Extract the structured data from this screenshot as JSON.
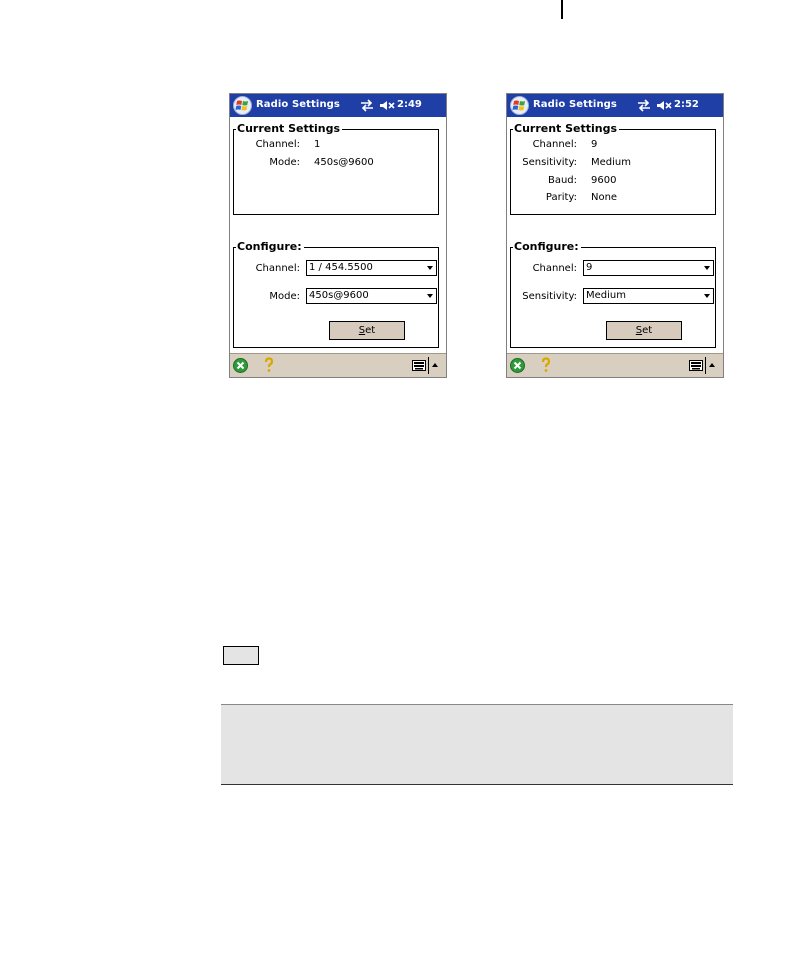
{
  "screens": [
    {
      "title": "Radio Settings",
      "time": "2:49",
      "current_title": "Current Settings",
      "current_rows": [
        {
          "label": "Channel:",
          "value": "1"
        },
        {
          "label": "Mode:",
          "value": "450s@9600"
        }
      ],
      "configure_title": "Configure:",
      "config_rows": [
        {
          "label": "Channel:",
          "value": "1 / 454.5500"
        },
        {
          "label": "Mode:",
          "value": "450s@9600"
        }
      ],
      "set_label_first": "S",
      "set_label_rest": "et"
    },
    {
      "title": "Radio Settings",
      "time": "2:52",
      "current_title": "Current Settings",
      "current_rows": [
        {
          "label": "Channel:",
          "value": "9"
        },
        {
          "label": "Sensitivity:",
          "value": "Medium"
        },
        {
          "label": "Baud:",
          "value": "9600"
        },
        {
          "label": "Parity:",
          "value": "None"
        }
      ],
      "configure_title": "Configure:",
      "config_rows": [
        {
          "label": "Channel:",
          "value": "9"
        },
        {
          "label": "Sensitivity:",
          "value": "Medium"
        }
      ],
      "set_label_first": "S",
      "set_label_rest": "et"
    }
  ],
  "colors": {
    "titlebar": "#1f3fa7",
    "bottombar": "#d9cfc1",
    "button": "#d6cbbd",
    "note_background": "#e4e4e4"
  },
  "icons": [
    "windows-start-icon",
    "sync-icon",
    "speaker-mute-icon",
    "ok-close-icon",
    "help-icon",
    "keyboard-icon",
    "combo-arrow-icon"
  ]
}
